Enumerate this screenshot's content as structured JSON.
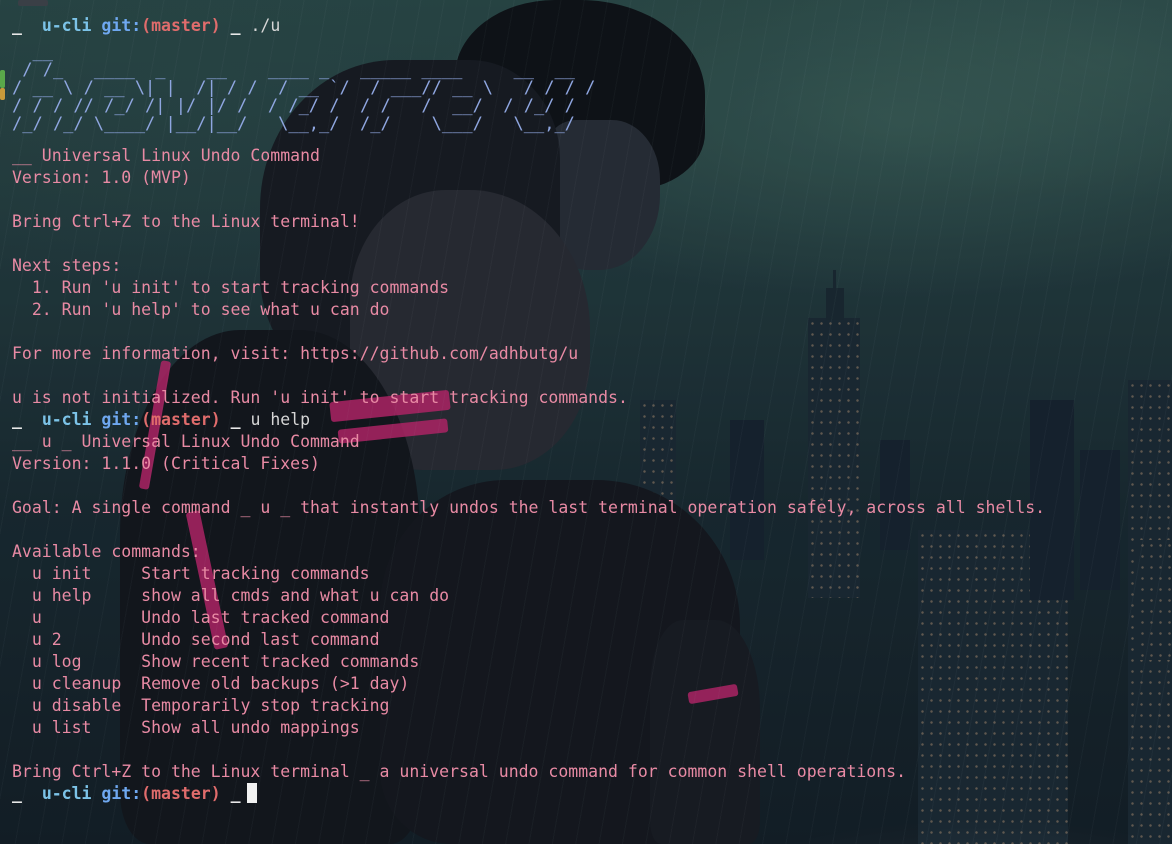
{
  "theme": {
    "text_color": "#e88aa4",
    "ascii_art_color": "#8fa6e0",
    "prompt_repo_color": "#7cc3e8",
    "prompt_git_color": "#6fa8f0",
    "prompt_branch_color": "#e06c6c",
    "cursor_color": "#f2f2f2"
  },
  "prompt": {
    "arrow": "_",
    "repo": "u-cli",
    "git_label": "git:",
    "branch": "(master)",
    "separator": "_"
  },
  "commands": {
    "first": "./u",
    "second": "u help"
  },
  "ascii_art": [
    "  __",
    " / /_   ____  _    __    ____ _   _____ ____     __  __",
    "/ __ \\ / __ \\| |  /| / /  / __ `/  / ___// __ \\   / / / /",
    "/ / / // /_/ /| |/ |/ /  / /_/ /  / /   /  __/  / /_/ /",
    "/_/ /_/ \\____/ |__/|__/   \\__,_/  /_/    \\___/   \\__,_/"
  ],
  "init_output": {
    "title": "__ Universal Linux Undo Command",
    "version": "Version: 1.0 (MVP)",
    "tagline": "Bring Ctrl+Z to the Linux terminal!",
    "next_steps_header": "Next steps:",
    "step1": "  1. Run 'u init' to start tracking commands",
    "step2": "  2. Run 'u help' to see what u can do",
    "more_info": "For more information, visit: https://github.com/adhbutg/u",
    "not_initialized": "u is not initialized. Run 'u init' to start tracking commands."
  },
  "help_output": {
    "title": "__ u _ Universal Linux Undo Command",
    "version": "Version: 1.1.0 (Critical Fixes)",
    "goal": "Goal: A single command _ u _ that instantly undos the last terminal operation safely, across all shells.",
    "available_header": "Available commands:",
    "commands": [
      {
        "name": "  u init     ",
        "desc": "Start tracking commands"
      },
      {
        "name": "  u help     ",
        "desc": "show all cmds and what u can do"
      },
      {
        "name": "  u          ",
        "desc": "Undo last tracked command"
      },
      {
        "name": "  u 2        ",
        "desc": "Undo second last command"
      },
      {
        "name": "  u log      ",
        "desc": "Show recent tracked commands"
      },
      {
        "name": "  u cleanup  ",
        "desc": "Remove old backups (>1 day)"
      },
      {
        "name": "  u disable  ",
        "desc": "Temporarily stop tracking"
      },
      {
        "name": "  u list     ",
        "desc": "Show all undo mappings"
      }
    ],
    "footer": "Bring Ctrl+Z to the Linux terminal _ a universal undo command for common shell operations."
  }
}
